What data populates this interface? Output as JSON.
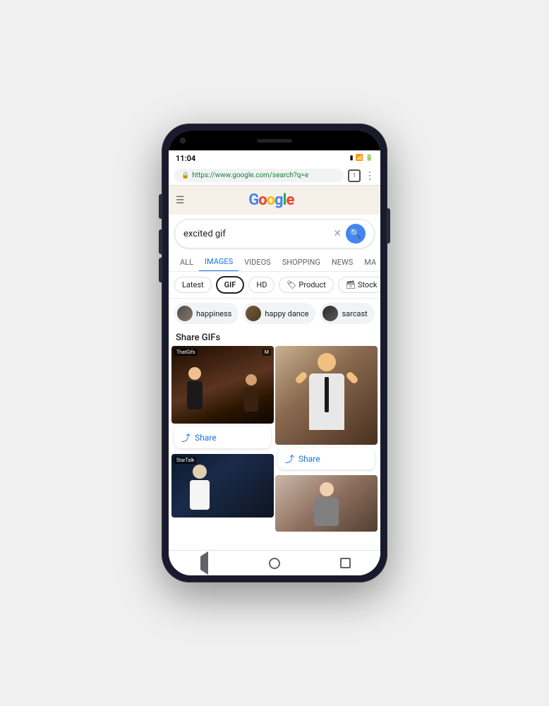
{
  "phone": {
    "status_bar": {
      "time": "11:04",
      "icons": "📶🔋"
    },
    "address_bar": {
      "url_green": "https://",
      "url_rest": "www.google.com/search?q=e",
      "tab_count": "1"
    },
    "search": {
      "query": "excited gif",
      "placeholder": "Search"
    },
    "tabs": [
      {
        "label": "ALL",
        "active": false
      },
      {
        "label": "IMAGES",
        "active": true
      },
      {
        "label": "VIDEOS",
        "active": false
      },
      {
        "label": "SHOPPING",
        "active": false
      },
      {
        "label": "NEWS",
        "active": false
      },
      {
        "label": "MA",
        "active": false
      }
    ],
    "filters": [
      {
        "label": "Latest",
        "type": "normal"
      },
      {
        "label": "GIF",
        "type": "bold"
      },
      {
        "label": "HD",
        "type": "normal"
      },
      {
        "label": "Product",
        "type": "product"
      },
      {
        "label": "Stock",
        "type": "stock"
      },
      {
        "label": "",
        "type": "red"
      },
      {
        "label": "",
        "type": "orange"
      }
    ],
    "suggestions": [
      {
        "label": "happiness",
        "avatar": "1"
      },
      {
        "label": "happy dance",
        "avatar": "2"
      },
      {
        "label": "sarcast",
        "avatar": "3"
      }
    ],
    "content": {
      "section_label": "Share GIFs",
      "gifs": [
        {
          "source": "ThatGifs",
          "badge": "M",
          "type": "party"
        },
        {
          "source": "",
          "badge": "",
          "type": "clapping"
        },
        {
          "source": "StarTalk",
          "badge": "",
          "type": "science"
        },
        {
          "source": "",
          "badge": "",
          "type": "reaction"
        }
      ],
      "share_label": "Share"
    },
    "navbar": {
      "back": "◄",
      "home": "●",
      "recents": "■"
    }
  }
}
